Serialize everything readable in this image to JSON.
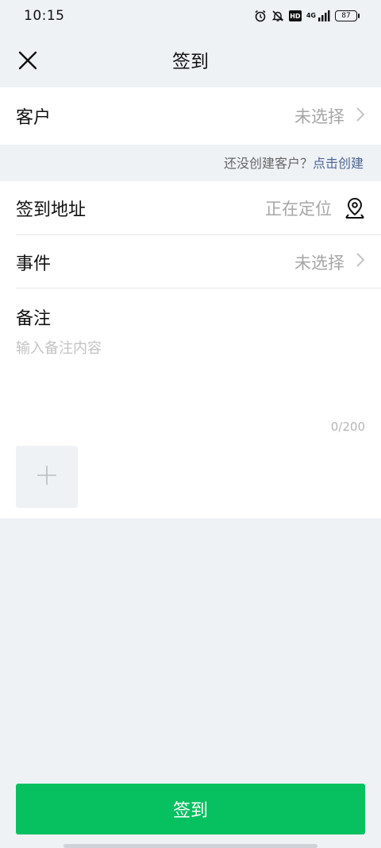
{
  "status_bar": {
    "time": "10:15",
    "network": "4G",
    "hd": "HD",
    "battery": "87"
  },
  "nav": {
    "title": "签到",
    "close_icon": "close-icon"
  },
  "customer": {
    "label": "客户",
    "value": "未选择"
  },
  "hint": {
    "text": "还没创建客户？",
    "link": "点击创建"
  },
  "address": {
    "label": "签到地址",
    "value": "正在定位",
    "icon": "location-pin-icon"
  },
  "event": {
    "label": "事件",
    "value": "未选择"
  },
  "notes": {
    "label": "备注",
    "placeholder": "输入备注内容",
    "counter": "0/200"
  },
  "submit": {
    "label": "签到"
  },
  "colors": {
    "accent": "#07c160",
    "link": "#4c6693",
    "background": "#eff2f5"
  }
}
